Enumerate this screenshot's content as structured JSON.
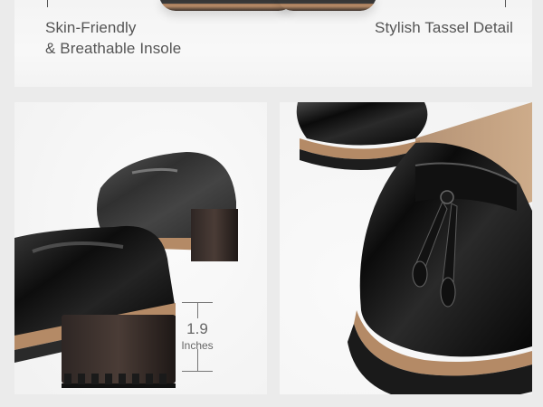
{
  "features": {
    "left_caption_line1": "Skin-Friendly",
    "left_caption_line2": "& Breathable Insole",
    "right_caption": "Stylish Tassel Detail"
  },
  "heel": {
    "value": "1.9",
    "unit": "Inches"
  }
}
